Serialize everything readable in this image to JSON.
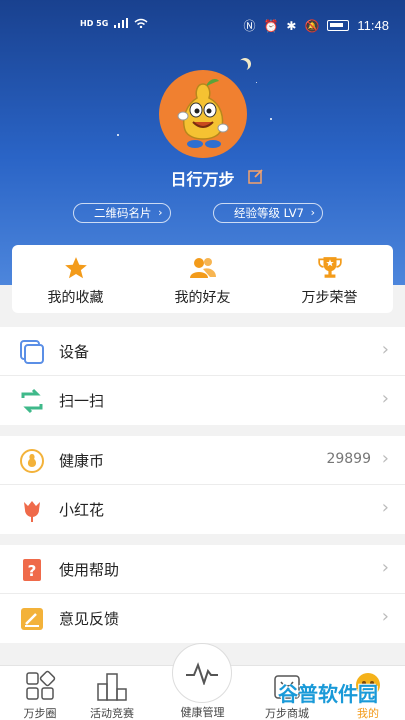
{
  "status_bar": {
    "left_text": "HD 5G",
    "time": "11:48"
  },
  "profile": {
    "name": "日行万步",
    "qr_label": "二维码名片",
    "level_label": "经验等级 LV7"
  },
  "quick_actions": [
    {
      "label": "我的收藏",
      "icon": "star-icon"
    },
    {
      "label": "我的好友",
      "icon": "friends-icon"
    },
    {
      "label": "万步荣誉",
      "icon": "trophy-icon"
    }
  ],
  "menu": {
    "device": "设备",
    "scan": "扫一扫",
    "coin": "健康币",
    "coin_value": "29899",
    "flower": "小红花",
    "help": "使用帮助",
    "feedback": "意见反馈"
  },
  "tabs": {
    "t1": "万步圈",
    "t2": "活动竞赛",
    "t3": "健康管理",
    "t4": "万步商城",
    "t5": "我的"
  },
  "watermark": "谷普软件园",
  "colors": {
    "accent": "#f39b1a",
    "header_top": "#19418f",
    "header_bottom": "#4d86dc"
  }
}
